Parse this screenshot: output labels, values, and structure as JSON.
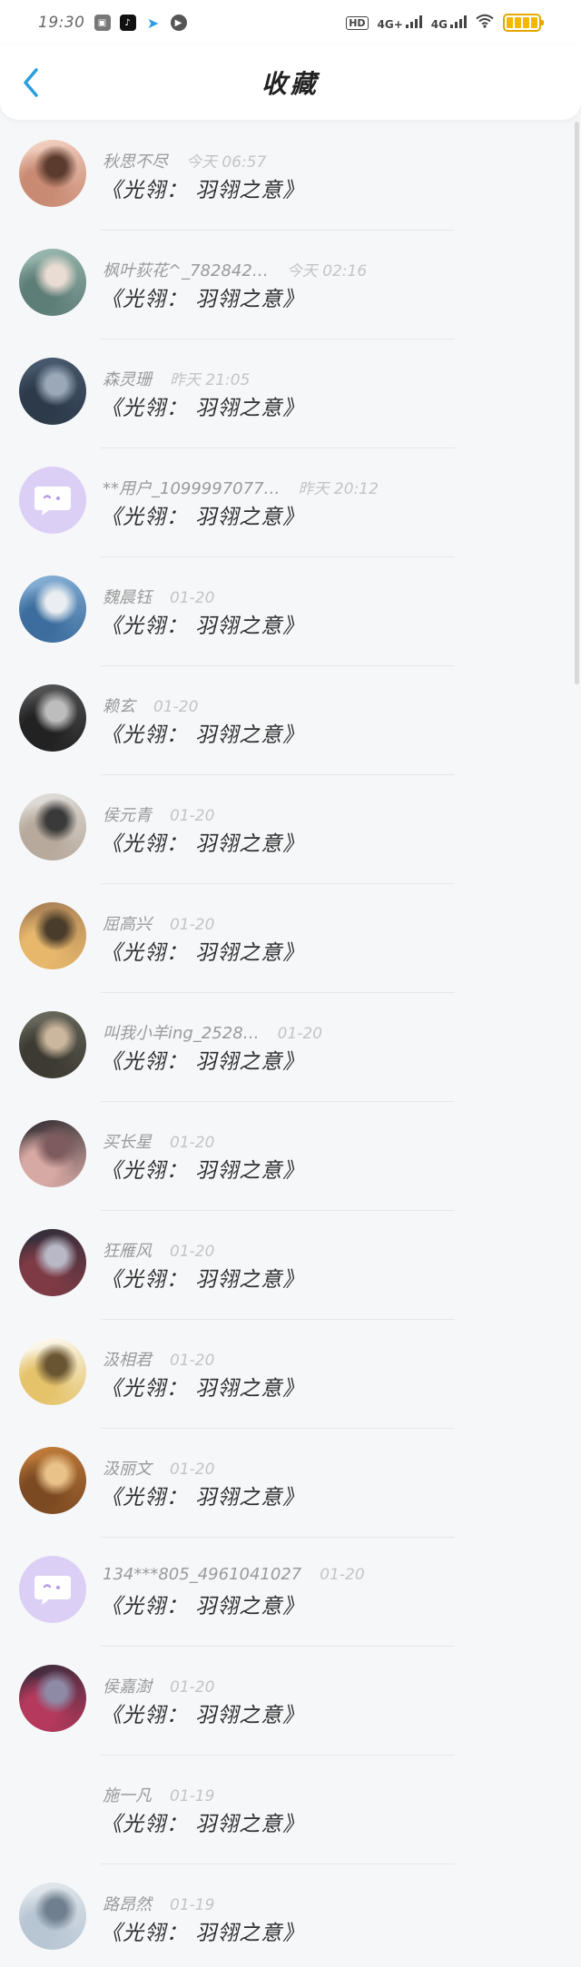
{
  "status_bar": {
    "time": "19:30",
    "hd_label": "HD",
    "network_1": "4G+",
    "network_2": "4G"
  },
  "header": {
    "title": "收藏"
  },
  "items": [
    {
      "name": "秋思不尽",
      "time": "今天 06:57",
      "content": "《光翎： 羽翎之意》",
      "avatar": {
        "type": "photo",
        "colors": [
          "#f6d7c8",
          "#c98a73",
          "#5b3b2e"
        ]
      }
    },
    {
      "name": "枫叶荻花^_782842…",
      "time": "今天 02:16",
      "content": "《光翎： 羽翎之意》",
      "avatar": {
        "type": "photo",
        "colors": [
          "#9fbdb3",
          "#5d7d77",
          "#e9dcd2"
        ]
      }
    },
    {
      "name": "森灵珊",
      "time": "昨天 21:05",
      "content": "《光翎： 羽翎之意》",
      "avatar": {
        "type": "photo",
        "colors": [
          "#4c5e73",
          "#2c3a4a",
          "#9aa8b8"
        ]
      }
    },
    {
      "name": "**用户_1099997077…",
      "time": "昨天 20:12",
      "content": "《光翎： 羽翎之意》",
      "avatar": {
        "type": "chat",
        "colors": [
          "#dccff5",
          "#ffffff",
          "#b69ae6"
        ]
      }
    },
    {
      "name": "魏晨钰",
      "time": "01-20",
      "content": "《光翎： 羽翎之意》",
      "avatar": {
        "type": "photo",
        "colors": [
          "#8fb7da",
          "#3c6d9e",
          "#eaeef2"
        ]
      }
    },
    {
      "name": "赖玄",
      "time": "01-20",
      "content": "《光翎： 羽翎之意》",
      "avatar": {
        "type": "photo",
        "colors": [
          "#5a5a5a",
          "#222222",
          "#bdbdbd"
        ]
      }
    },
    {
      "name": "侯元青",
      "time": "01-20",
      "content": "《光翎： 羽翎之意》",
      "avatar": {
        "type": "photo",
        "colors": [
          "#e5e3e0",
          "#b7a99b",
          "#3a3a3a"
        ]
      }
    },
    {
      "name": "屈高兴",
      "time": "01-20",
      "content": "《光翎： 羽翎之意》",
      "avatar": {
        "type": "photo",
        "colors": [
          "#a57d54",
          "#e7b76c",
          "#4a3c2a"
        ]
      }
    },
    {
      "name": "叫我小羊ing_2528…",
      "time": "01-20",
      "content": "《光翎： 羽翎之意》",
      "avatar": {
        "type": "photo",
        "colors": [
          "#6e6e62",
          "#3c3a32",
          "#cbb79d"
        ]
      }
    },
    {
      "name": "买长星",
      "time": "01-20",
      "content": "《光翎： 羽翎之意》",
      "avatar": {
        "type": "photo",
        "colors": [
          "#2e2a2f",
          "#d7a9a4",
          "#7e5b5e"
        ]
      }
    },
    {
      "name": "狂雁风",
      "time": "01-20",
      "content": "《光翎： 羽翎之意》",
      "avatar": {
        "type": "photo",
        "colors": [
          "#2b2d3a",
          "#7f3b45",
          "#b8b8c6"
        ]
      }
    },
    {
      "name": "汲相君",
      "time": "01-20",
      "content": "《光翎： 羽翎之意》",
      "avatar": {
        "type": "photo",
        "colors": [
          "#ffffff",
          "#e4c36a",
          "#6a5532"
        ]
      }
    },
    {
      "name": "汲丽文",
      "time": "01-20",
      "content": "《光翎： 羽翎之意》",
      "avatar": {
        "type": "photo",
        "colors": [
          "#c7813c",
          "#7c4a22",
          "#e9c28a"
        ]
      }
    },
    {
      "name": "134***805_4961041027",
      "time": "01-20",
      "content": "《光翎： 羽翎之意》",
      "avatar": {
        "type": "chat",
        "colors": [
          "#dccff5",
          "#ffffff",
          "#b69ae6"
        ]
      }
    },
    {
      "name": "侯嘉澍",
      "time": "01-20",
      "content": "《光翎： 羽翎之意》",
      "avatar": {
        "type": "photo",
        "colors": [
          "#332a3a",
          "#b4395c",
          "#8e8aa6"
        ]
      }
    },
    {
      "name": "施一凡",
      "time": "01-19",
      "content": "《光翎： 羽翎之意》",
      "avatar": {
        "type": "blank",
        "colors": [
          "#f6f7f9",
          "#f6f7f9",
          "#f6f7f9"
        ]
      }
    },
    {
      "name": "路昂然",
      "time": "01-19",
      "content": "《光翎： 羽翎之意》",
      "avatar": {
        "type": "photo",
        "colors": [
          "#e6ebef",
          "#b8c6d3",
          "#6f7f8f"
        ]
      }
    }
  ]
}
